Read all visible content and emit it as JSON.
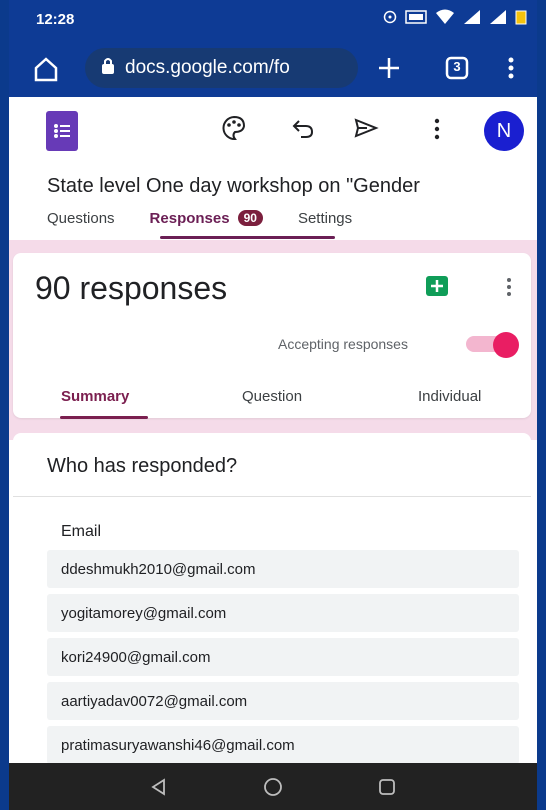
{
  "status_bar": {
    "time": "12:28",
    "icons": [
      "hotspot-icon",
      "volte-icon",
      "wifi-icon",
      "signal-icon",
      "battery-icon"
    ]
  },
  "browser": {
    "url": "docs.google.com/fo",
    "tab_count": "3",
    "icons": [
      "home-icon",
      "lock-icon",
      "new-tab-icon",
      "tabs-icon",
      "more-vert-icon"
    ]
  },
  "forms_toolbar": {
    "avatar_letter": "N",
    "icons": [
      "forms-logo-icon",
      "palette-icon",
      "undo-icon",
      "send-icon",
      "more-vert-icon"
    ]
  },
  "form": {
    "title": "State level One day workshop on \"Gender",
    "tabs": {
      "questions": "Questions",
      "responses": "Responses",
      "responses_count": "90",
      "settings": "Settings"
    }
  },
  "responses_card": {
    "title": "90 responses",
    "accepting_label": "Accepting responses",
    "accepting_on": true,
    "subtabs": {
      "summary": "Summary",
      "question": "Question",
      "individual": "Individual"
    }
  },
  "who_responded": {
    "heading": "Who has responded?",
    "email_label": "Email",
    "emails": [
      "ddeshmukh2010@gmail.com",
      "yogitamorey@gmail.com",
      "kori24900@gmail.com",
      "aartiyadav0072@gmail.com",
      "pratimasuryawanshi46@gmail.com"
    ]
  },
  "nav_bar": {
    "icons": [
      "back-triangle-icon",
      "home-circle-icon",
      "recents-square-icon"
    ]
  },
  "colors": {
    "status_bar_bg": "#0e3b95",
    "accent": "#6b1f55",
    "forms_purple": "#673ab7",
    "avatar_blue": "#1a1fd0",
    "toggle_pink": "#e91e63",
    "band_pink": "#f5dbe9",
    "sheets_green": "#0f9d58"
  }
}
